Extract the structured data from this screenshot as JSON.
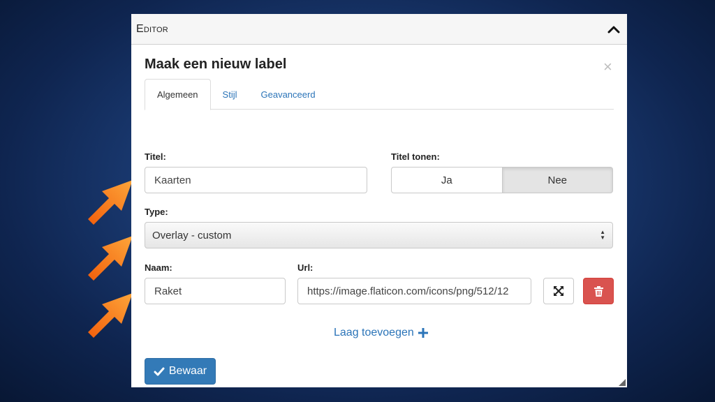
{
  "panel": {
    "title": "Editor"
  },
  "modal": {
    "title": "Maak een nieuw label",
    "close": "×"
  },
  "tabs": [
    {
      "label": "Algemeen",
      "active": true
    },
    {
      "label": "Stijl",
      "active": false
    },
    {
      "label": "Geavanceerd",
      "active": false
    }
  ],
  "form": {
    "title_label": "Titel:",
    "title_value": "Kaarten",
    "show_title_label": "Titel tonen:",
    "show_title_options": [
      "Ja",
      "Nee"
    ],
    "show_title_selected": "Nee",
    "type_label": "Type:",
    "type_value": "Overlay - custom",
    "name_label": "Naam:",
    "name_value": "Raket",
    "url_label": "Url:",
    "url_value": "https://image.flaticon.com/icons/png/512/12",
    "add_layer": "Laag toevoegen",
    "save": "Bewaar"
  },
  "icons": {
    "collapse": "chevron-up-icon",
    "expand": "expand-arrows-icon",
    "delete": "trash-icon",
    "add": "plus-icon",
    "save": "check-icon"
  },
  "colors": {
    "accent": "#337ab7",
    "link": "#2b74b8",
    "danger": "#d9534f",
    "annotation_arrow": "#f68b1f"
  }
}
